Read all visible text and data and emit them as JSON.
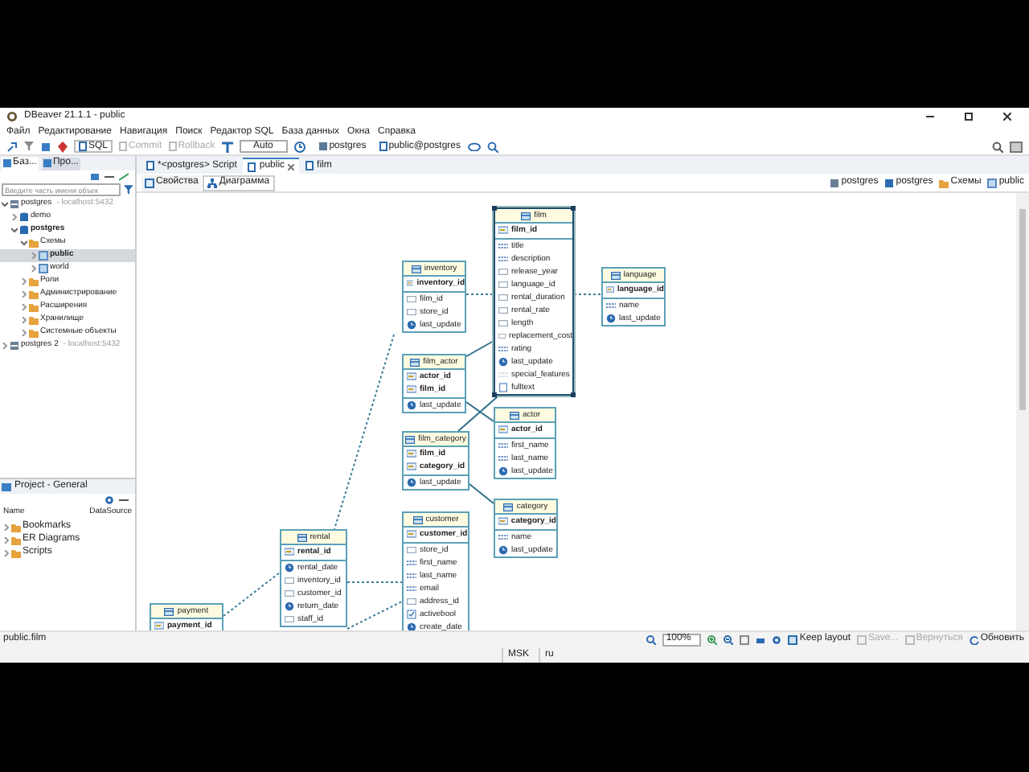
{
  "window": {
    "title": "DBeaver 21.1.1 - public"
  },
  "menu": [
    "Файл",
    "Редактирование",
    "Навигация",
    "Поиск",
    "Редактор SQL",
    "База данных",
    "Окна",
    "Справка"
  ],
  "toolbar": {
    "sql": "SQL",
    "commit": {
      "label": "Commit",
      "disabled": true
    },
    "rollback": {
      "label": "Rollback",
      "disabled": true
    },
    "mode": "Auto",
    "datasource": "postgres",
    "schema": "public@postgres"
  },
  "navigator": {
    "tabs": [
      {
        "label": "Баз...",
        "selected": true
      },
      {
        "label": "Про...",
        "selected": false
      }
    ],
    "search": {
      "placeholder": "Введите часть имени объек"
    },
    "tree": [
      {
        "label": "postgres",
        "detail": "- localhost:5432",
        "kind": "connection",
        "expanded": true,
        "selected": false,
        "children": [
          {
            "label": "demo",
            "kind": "database",
            "expanded": false,
            "selected": false
          },
          {
            "label": "postgres",
            "kind": "database",
            "expanded": true,
            "selected": false,
            "bold": true,
            "children": [
              {
                "label": "Схемы",
                "kind": "folder",
                "expanded": true,
                "selected": false,
                "children": [
                  {
                    "label": "public",
                    "kind": "schema",
                    "expanded": false,
                    "selected": true,
                    "bold": true
                  },
                  {
                    "label": "world",
                    "kind": "schema",
                    "expanded": false,
                    "selected": false
                  }
                ]
              },
              {
                "label": "Роли",
                "kind": "folder",
                "expanded": false,
                "selected": false
              },
              {
                "label": "Администрирование",
                "kind": "folder",
                "expanded": false,
                "selected": false
              },
              {
                "label": "Расширения",
                "kind": "folder",
                "expanded": false,
                "selected": false
              },
              {
                "label": "Хранилище",
                "kind": "folder",
                "expanded": false,
                "selected": false
              },
              {
                "label": "Системные объекты",
                "kind": "folder",
                "expanded": false,
                "selected": false
              }
            ]
          }
        ]
      },
      {
        "label": "postgres 2",
        "detail": "- localhost:5432",
        "kind": "connection",
        "expanded": false,
        "selected": false
      }
    ]
  },
  "project": {
    "title": "Project - General",
    "columns": [
      "Name",
      "DataSource"
    ],
    "items": [
      "Bookmarks",
      "ER Diagrams",
      "Scripts"
    ]
  },
  "editor_tabs": [
    {
      "label": "*<postgres> Script",
      "selected": false
    },
    {
      "label": "public",
      "selected": true
    },
    {
      "label": "film",
      "selected": false
    }
  ],
  "sub_tabs": [
    {
      "label": "Свойства",
      "selected": false
    },
    {
      "label": "Диаграмма",
      "selected": true
    }
  ],
  "breadcrumbs": [
    "postgres",
    "postgres",
    "Схемы",
    "public"
  ],
  "diagram": {
    "tables": [
      {
        "name": "payment",
        "selected": false,
        "columns": [
          {
            "name": "payment_id",
            "kind": "key"
          }
        ]
      },
      {
        "name": "rental",
        "selected": false,
        "columns": [
          {
            "name": "rental_id",
            "kind": "key"
          },
          {
            "name": "rental_date",
            "kind": "date"
          },
          {
            "name": "inventory_id",
            "kind": "number"
          },
          {
            "name": "customer_id",
            "kind": "number"
          },
          {
            "name": "return_date",
            "kind": "date"
          },
          {
            "name": "staff_id",
            "kind": "number"
          }
        ]
      },
      {
        "name": "inventory",
        "selected": false,
        "columns": [
          {
            "name": "inventory_id",
            "kind": "key"
          },
          {
            "name": "film_id",
            "kind": "number"
          },
          {
            "name": "store_id",
            "kind": "number"
          },
          {
            "name": "last_update",
            "kind": "date"
          }
        ]
      },
      {
        "name": "film_actor",
        "selected": false,
        "columns": [
          {
            "name": "actor_id",
            "kind": "key"
          },
          {
            "name": "film_id",
            "kind": "key"
          },
          {
            "name": "last_update",
            "kind": "date"
          }
        ]
      },
      {
        "name": "film_category",
        "selected": false,
        "columns": [
          {
            "name": "film_id",
            "kind": "key"
          },
          {
            "name": "category_id",
            "kind": "key"
          },
          {
            "name": "last_update",
            "kind": "date"
          }
        ]
      },
      {
        "name": "customer",
        "selected": false,
        "columns": [
          {
            "name": "customer_id",
            "kind": "key"
          },
          {
            "name": "store_id",
            "kind": "number"
          },
          {
            "name": "first_name",
            "kind": "text"
          },
          {
            "name": "last_name",
            "kind": "text"
          },
          {
            "name": "email",
            "kind": "text"
          },
          {
            "name": "address_id",
            "kind": "number"
          },
          {
            "name": "activebool",
            "kind": "bool"
          },
          {
            "name": "create_date",
            "kind": "date"
          }
        ]
      },
      {
        "name": "film",
        "selected": true,
        "columns": [
          {
            "name": "film_id",
            "kind": "key"
          },
          {
            "name": "title",
            "kind": "text"
          },
          {
            "name": "description",
            "kind": "text"
          },
          {
            "name": "release_year",
            "kind": "number"
          },
          {
            "name": "language_id",
            "kind": "number"
          },
          {
            "name": "rental_duration",
            "kind": "number"
          },
          {
            "name": "rental_rate",
            "kind": "number"
          },
          {
            "name": "length",
            "kind": "number"
          },
          {
            "name": "replacement_cost",
            "kind": "number"
          },
          {
            "name": "rating",
            "kind": "text"
          },
          {
            "name": "last_update",
            "kind": "date"
          },
          {
            "name": "special_features",
            "kind": "array"
          },
          {
            "name": "fulltext",
            "kind": "fulltext"
          }
        ]
      },
      {
        "name": "actor",
        "selected": false,
        "columns": [
          {
            "name": "actor_id",
            "kind": "key"
          },
          {
            "name": "first_name",
            "kind": "text"
          },
          {
            "name": "last_name",
            "kind": "text"
          },
          {
            "name": "last_update",
            "kind": "date"
          }
        ]
      },
      {
        "name": "category",
        "selected": false,
        "columns": [
          {
            "name": "category_id",
            "kind": "key"
          },
          {
            "name": "name",
            "kind": "text"
          },
          {
            "name": "last_update",
            "kind": "date"
          }
        ]
      },
      {
        "name": "language",
        "selected": false,
        "columns": [
          {
            "name": "language_id",
            "kind": "key"
          },
          {
            "name": "name",
            "kind": "text"
          },
          {
            "name": "last_update",
            "kind": "date"
          }
        ]
      }
    ]
  },
  "path": "public.film",
  "diagram_toolbar": {
    "zoom": "100%",
    "keep_layout": "Keep layout",
    "save": {
      "label": "Save...",
      "disabled": true
    },
    "revert": {
      "label": "Вернуться",
      "disabled": true
    },
    "refresh": "Обновить"
  },
  "status_bar": [
    "MSK",
    "ru"
  ]
}
